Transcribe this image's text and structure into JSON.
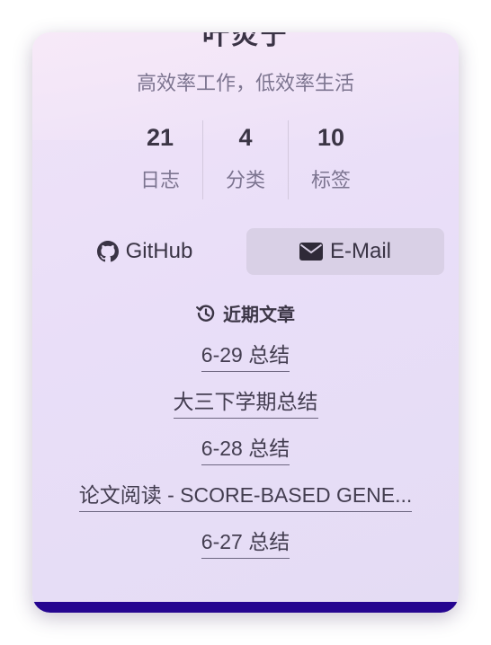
{
  "author": {
    "name": "叶炎宁",
    "motto": "高效率工作，低效率生活"
  },
  "stats": [
    {
      "count": "21",
      "label": "日志"
    },
    {
      "count": "4",
      "label": "分类"
    },
    {
      "count": "10",
      "label": "标签"
    }
  ],
  "links": {
    "github": {
      "label": "GitHub",
      "icon": "github-icon"
    },
    "email": {
      "label": "E-Mail",
      "icon": "envelope-icon"
    }
  },
  "recent_posts": {
    "title": "近期文章",
    "icon": "history-icon",
    "items": [
      "6-29 总结",
      "大三下学期总结",
      "6-28 总结",
      "论文阅读 - SCORE-BASED GENE...",
      "6-27 总结"
    ]
  },
  "colors": {
    "card_gradient_start": "#efe3f7",
    "card_gradient_end": "#e4dcf4",
    "email_button_bg": "#d9d0e6",
    "footer_bar": "#250590",
    "text_primary": "#3b3545",
    "text_secondary": "#7c7490"
  }
}
